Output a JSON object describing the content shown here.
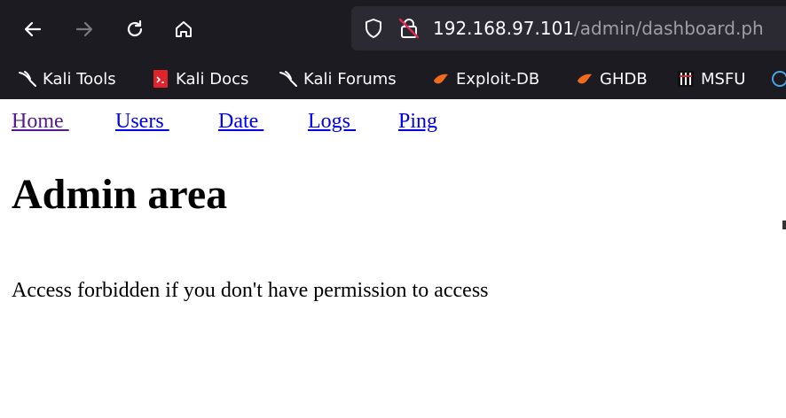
{
  "browser": {
    "url_host": "192.168.97.101",
    "url_path": "/admin/dashboard.ph",
    "bookmarks": [
      {
        "label": "Kali Tools",
        "icon": "kali-dragon-icon"
      },
      {
        "label": "Kali Docs",
        "icon": "kali-docs-icon"
      },
      {
        "label": "Kali Forums",
        "icon": "kali-dragon-icon"
      },
      {
        "label": "Exploit-DB",
        "icon": "exploit-db-icon"
      },
      {
        "label": "GHDB",
        "icon": "ghdb-icon"
      },
      {
        "label": "MSFU",
        "icon": "msfu-icon"
      }
    ],
    "colors": {
      "chrome_bg": "#1c1b22",
      "urlbar_bg": "#2b2a33",
      "exploit_orange": "#f26b1d",
      "docs_red": "#e0242b"
    }
  },
  "page": {
    "nav": [
      {
        "label": "Home "
      },
      {
        "label": "Users "
      },
      {
        "label": "Date "
      },
      {
        "label": "Logs "
      },
      {
        "label": "Ping"
      }
    ],
    "title": "Admin area",
    "message": "Access forbidden if you don't have permission to access"
  }
}
